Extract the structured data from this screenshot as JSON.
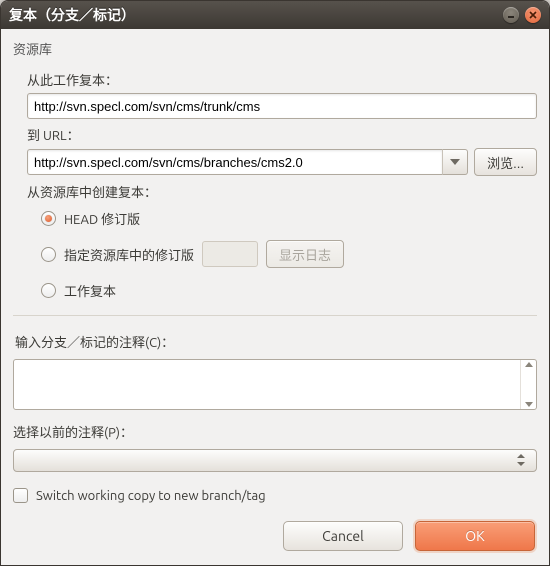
{
  "window": {
    "title": "复本（分支／标记）"
  },
  "repo": {
    "header": "资源库",
    "from_label": "从此工作复本：",
    "from_value": "http://svn.specl.com/svn/cms/trunk/cms",
    "to_label": "到 URL：",
    "to_value": "http://svn.specl.com/svn/cms/branches/cms2.0",
    "browse_label": "浏览...",
    "create_label": "从资源库中创建复本：",
    "radio": {
      "head": "HEAD 修订版",
      "specific": "指定资源库中的修订版",
      "show_log": "显示日志",
      "working_copy": "工作复本"
    }
  },
  "comment": {
    "enter_label": "输入分支／标记的注释(C)：",
    "text": "",
    "select_label": "选择以前的注释(P)：",
    "selected": ""
  },
  "switch": {
    "label": "Switch working copy to new branch/tag",
    "checked": false
  },
  "buttons": {
    "cancel": "Cancel",
    "ok": "OK"
  }
}
